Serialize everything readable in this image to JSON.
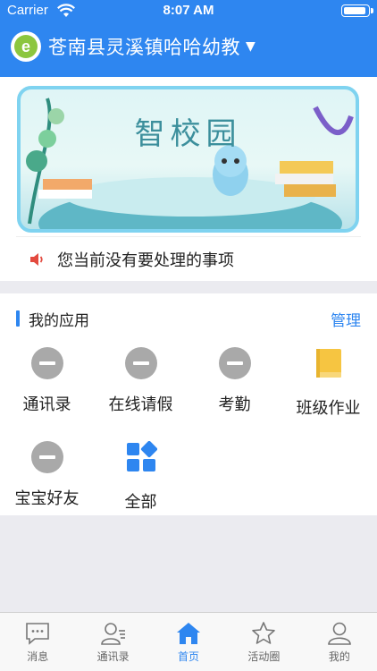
{
  "status_bar": {
    "carrier": "Carrier",
    "time": "8:07 AM"
  },
  "header": {
    "school_name": "苍南县灵溪镇哈哈幼教",
    "logo_letter": "e"
  },
  "banner": {
    "title": "智校园"
  },
  "notice": {
    "text": "您当前没有要处理的事项"
  },
  "apps_section": {
    "title": "我的应用",
    "manage_label": "管理",
    "apps": [
      {
        "label": "通讯录",
        "icon": "minus-circle-icon"
      },
      {
        "label": "在线请假",
        "icon": "minus-circle-icon"
      },
      {
        "label": "考勤",
        "icon": "minus-circle-icon"
      },
      {
        "label": "班级作业",
        "icon": "book-icon"
      },
      {
        "label": "宝宝好友",
        "icon": "minus-circle-icon"
      },
      {
        "label": "全部",
        "icon": "grid-icon"
      }
    ]
  },
  "tabbar": {
    "tabs": [
      {
        "label": "消息",
        "icon": "message-icon",
        "active": false
      },
      {
        "label": "通讯录",
        "icon": "contacts-icon",
        "active": false
      },
      {
        "label": "首页",
        "icon": "home-icon",
        "active": true
      },
      {
        "label": "活动圈",
        "icon": "star-icon",
        "active": false
      },
      {
        "label": "我的",
        "icon": "profile-icon",
        "active": false
      }
    ]
  },
  "colors": {
    "primary": "#2e86f0",
    "book": "#f6c541",
    "grid": "#2e86f0",
    "inactive": "#a9a9a9"
  }
}
